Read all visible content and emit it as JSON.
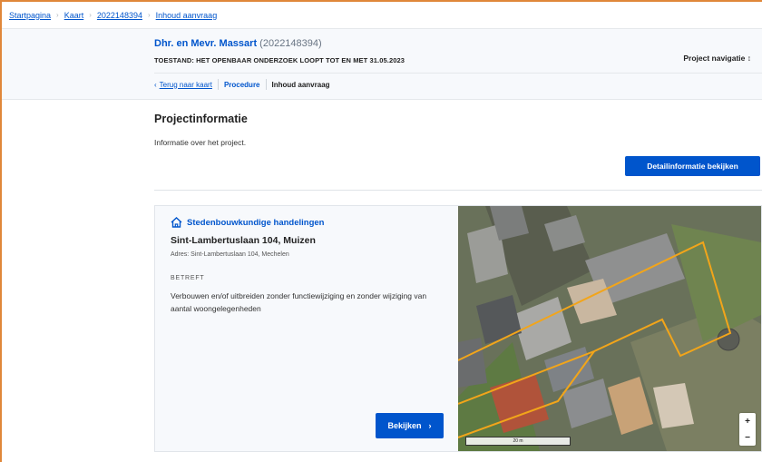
{
  "breadcrumb": {
    "items": [
      "Startpagina",
      "Kaart",
      "2022148394",
      "Inhoud aanvraag"
    ]
  },
  "header": {
    "applicant": "Dhr. en Mevr. Massart",
    "reference": "(2022148394)",
    "state": "TOESTAND: HET OPENBAAR ONDERZOEK LOOPT TOT EN MET 31.05.2023",
    "project_nav": "Project navigatie",
    "subnav": {
      "back": "Terug naar kaart",
      "procedure": "Procedure",
      "current": "Inhoud aanvraag"
    }
  },
  "section": {
    "title": "Projectinformatie",
    "description": "Informatie over het project.",
    "detail_button": "Detailinformatie bekijken"
  },
  "card": {
    "type": "Stedenbouwkundige handelingen",
    "title": "Sint-Lambertuslaan 104, Muizen",
    "address": "Adres: Sint-Lambertuslaan 104, Mechelen",
    "concerns_label": "BETREFT",
    "concerns_text": "Verbouwen en/of uitbreiden zonder functiewijziging en zonder wijziging van aantal woongelegenheden",
    "view_button": "Bekijken"
  },
  "map": {
    "zoom_in": "+",
    "zoom_out": "−",
    "scale": "20 m",
    "parcel_color": "#f2a51a"
  },
  "colors": {
    "primary": "#0055cc",
    "frame": "#e0873a"
  },
  "icons": {
    "home": "home-icon",
    "chevron_right": "chevron-right-icon",
    "chevron_left": "chevron-left-icon",
    "updown": "updown-icon"
  }
}
